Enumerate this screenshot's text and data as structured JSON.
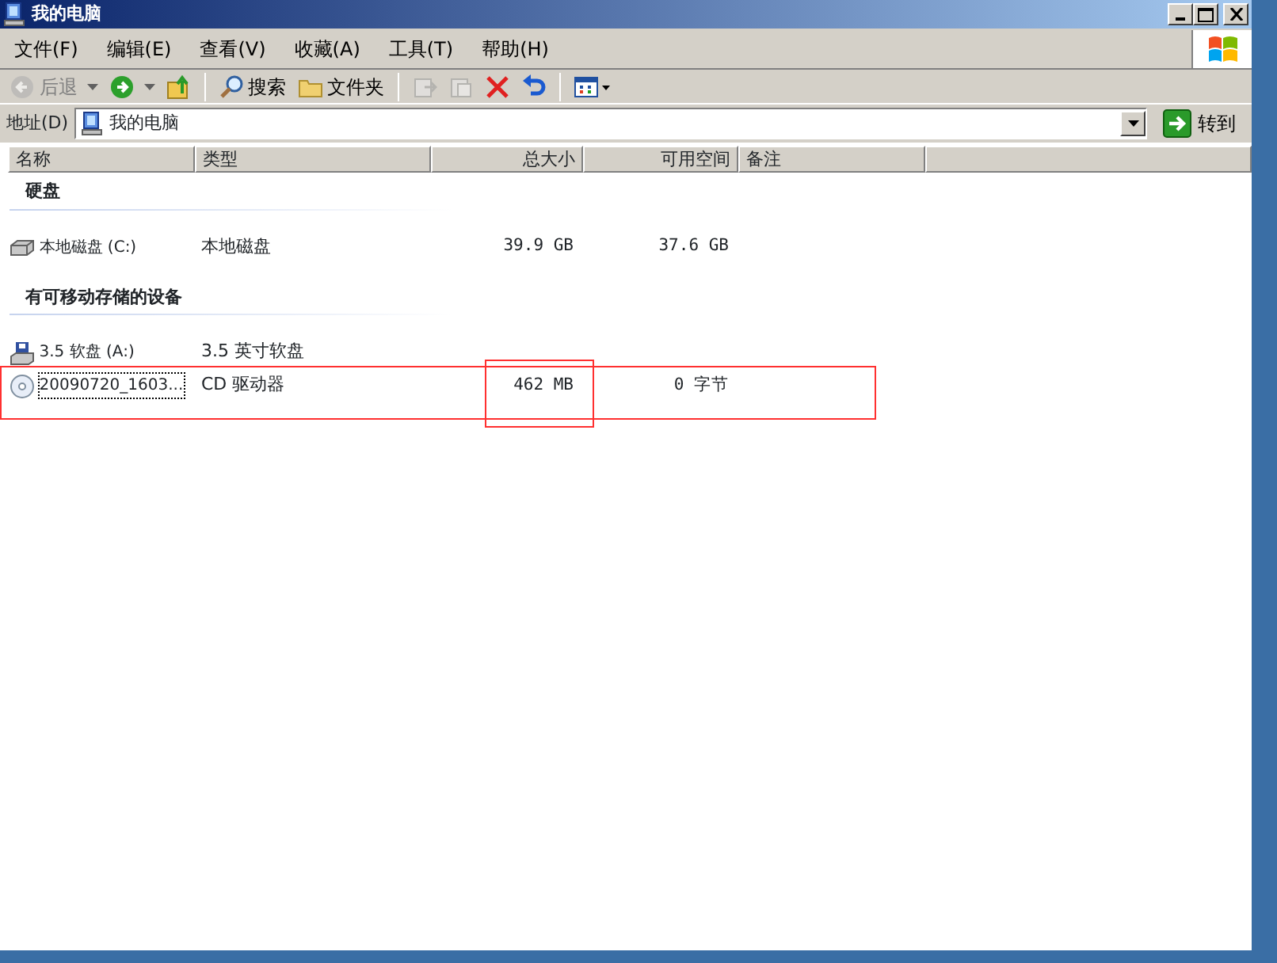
{
  "window": {
    "title": "我的电脑"
  },
  "menu": [
    {
      "label": "文件(F)"
    },
    {
      "label": "编辑(E)"
    },
    {
      "label": "查看(V)"
    },
    {
      "label": "收藏(A)"
    },
    {
      "label": "工具(T)"
    },
    {
      "label": "帮助(H)"
    }
  ],
  "toolbar": [
    {
      "kind": "back",
      "label": "后退",
      "disabled": true
    },
    {
      "kind": "forward",
      "disabled": false
    },
    {
      "kind": "up",
      "disabled": false
    },
    {
      "kind": "sep"
    },
    {
      "kind": "search",
      "label": "搜索",
      "disabled": false
    },
    {
      "kind": "folders",
      "label": "文件夹",
      "disabled": false
    },
    {
      "kind": "sep"
    },
    {
      "kind": "move",
      "disabled": true
    },
    {
      "kind": "copy",
      "disabled": true
    },
    {
      "kind": "delete",
      "disabled": false
    },
    {
      "kind": "undo",
      "disabled": false
    },
    {
      "kind": "sep"
    },
    {
      "kind": "views",
      "disabled": false
    }
  ],
  "address": {
    "label": "地址(D)",
    "value": "我的电脑",
    "go": "转到"
  },
  "columns": [
    "名称",
    "类型",
    "总大小",
    "可用空间",
    "备注"
  ],
  "groups": [
    {
      "title": "硬盘",
      "items": [
        {
          "kind": "disk",
          "name": "本地磁盘 (C:)",
          "type": "本地磁盘",
          "size": "39.9 GB",
          "free": "37.6 GB",
          "focused": false,
          "highlighted": false
        }
      ]
    },
    {
      "title": "有可移动存储的设备",
      "items": [
        {
          "kind": "floppy",
          "name": "3.5 软盘 (A:)",
          "type": "3.5 英寸软盘",
          "focused": false,
          "highlighted": false
        },
        {
          "kind": "cd",
          "name": "20090720_1603...",
          "type": "CD 驱动器",
          "size": "462 MB",
          "free": "0 字节",
          "focused": true,
          "highlighted": true
        }
      ]
    }
  ]
}
